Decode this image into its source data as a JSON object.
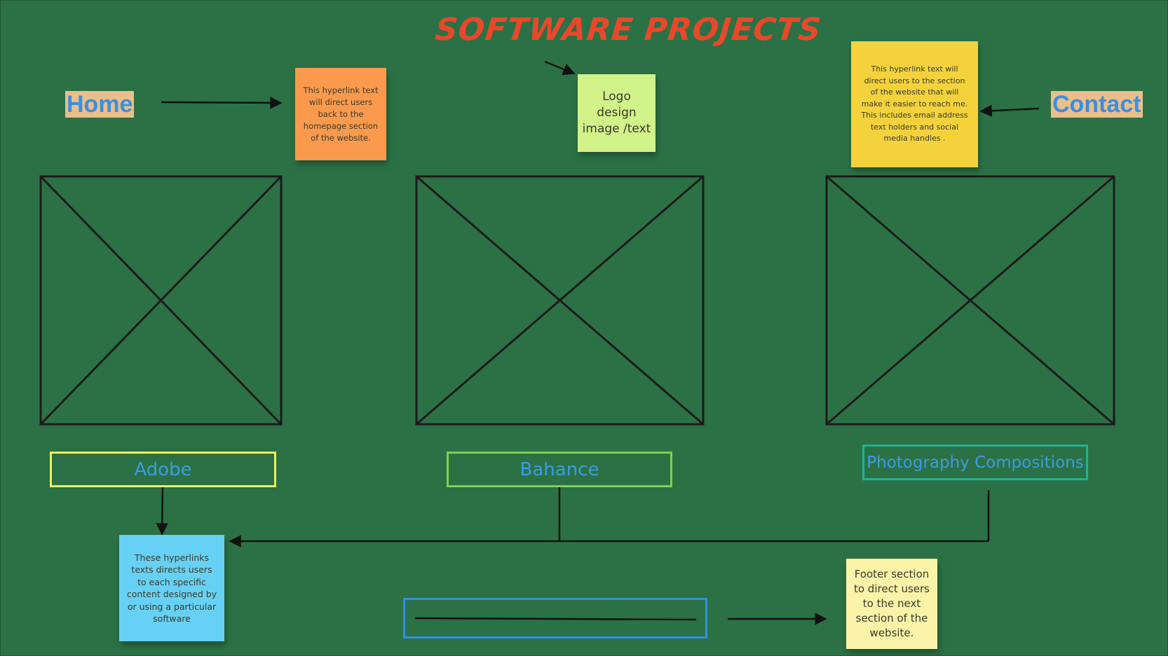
{
  "board": {
    "title": "SOFTWARE PROJECTS",
    "nav": {
      "home_label": "Home",
      "contact_label": "Contact"
    },
    "notes": {
      "home": "This hyperlink text will direct users back to the homepage section of the website.",
      "logo": "Logo design image /text",
      "contact": "This hyperlink text will direct users to the section of the website that will make it easier to reach me. This includes email address text holders and social media handles .",
      "software": "These hyperlinks texts directs users to each specific content designed by or using a particular software",
      "footer": "Footer section to direct users to the next section of the website."
    },
    "software_links": [
      "Adobe",
      "Bahance",
      "Photography Compositions"
    ],
    "image_placeholders": [
      "image-placeholder-adobe",
      "image-placeholder-bahance",
      "image-placeholder-photography"
    ]
  },
  "colors": {
    "board_background": "#2b7145",
    "title": "#e8482b",
    "nav_text": "#3b8fe0",
    "nav_highlight": "#eabf8a",
    "note_home": "#fb9a4d",
    "note_logo": "#d2f28a",
    "note_contact": "#f4d23c",
    "note_software": "#67d1f5",
    "note_footer": "#faf3a8",
    "border_adobe": "#eef05a",
    "border_bahance": "#7dd24f",
    "border_photography": "#1fb391",
    "border_footer": "#2f90e8"
  }
}
